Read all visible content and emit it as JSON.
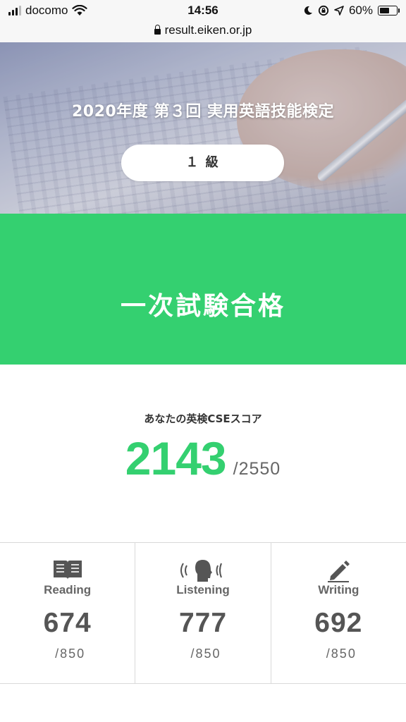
{
  "status_bar": {
    "carrier": "docomo",
    "time": "14:56",
    "battery_percent": "60%",
    "battery_level": 0.6
  },
  "browser": {
    "url": "result.eiken.or.jp"
  },
  "hero": {
    "title": "2020年度 第３回 実用英語技能検定",
    "grade": "１ 級"
  },
  "result": {
    "status": "一次試験合格"
  },
  "score": {
    "label": "あなたの英検CSEスコア",
    "value": "2143",
    "max": "/2550",
    "accent_color": "#34d070"
  },
  "skills": [
    {
      "name": "Reading",
      "icon": "book-icon",
      "score": "674",
      "max": "/850"
    },
    {
      "name": "Listening",
      "icon": "speaking-head-icon",
      "score": "777",
      "max": "/850"
    },
    {
      "name": "Writing",
      "icon": "pencil-icon",
      "score": "692",
      "max": "/850"
    }
  ]
}
